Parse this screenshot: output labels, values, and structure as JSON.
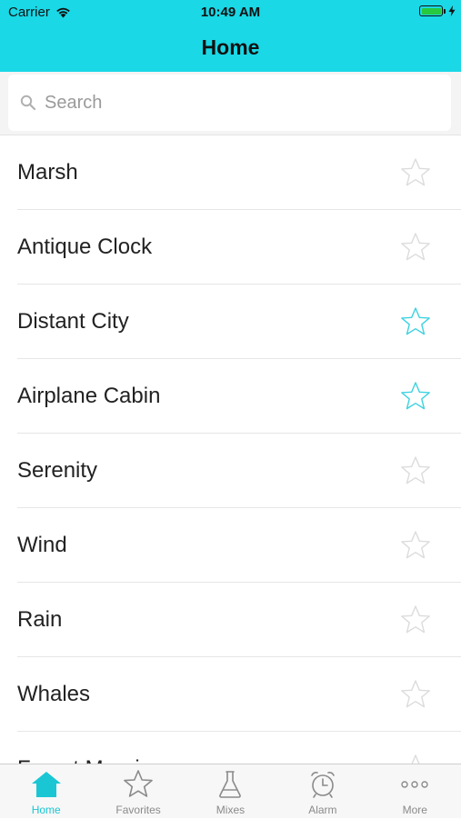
{
  "status_bar": {
    "carrier": "Carrier",
    "time": "10:49 AM",
    "battery_level": 1.0
  },
  "nav": {
    "title": "Home"
  },
  "search": {
    "placeholder": "Search",
    "value": ""
  },
  "colors": {
    "accent": "#1ad8e6",
    "star_inactive": "#dcdcdc",
    "star_active": "#3fd2e0",
    "tab_active": "#1ac6d4",
    "tab_inactive": "#8a8a8a"
  },
  "sounds": [
    {
      "name": "Marsh",
      "favorite": false
    },
    {
      "name": "Antique Clock",
      "favorite": false
    },
    {
      "name": "Distant City",
      "favorite": true
    },
    {
      "name": "Airplane Cabin",
      "favorite": true
    },
    {
      "name": "Serenity",
      "favorite": false
    },
    {
      "name": "Wind",
      "favorite": false
    },
    {
      "name": "Rain",
      "favorite": false
    },
    {
      "name": "Whales",
      "favorite": false
    },
    {
      "name": "Forest Morning",
      "favorite": false
    }
  ],
  "tabs": [
    {
      "label": "Home",
      "icon": "home-icon",
      "active": true
    },
    {
      "label": "Favorites",
      "icon": "star-icon",
      "active": false
    },
    {
      "label": "Mixes",
      "icon": "flask-icon",
      "active": false
    },
    {
      "label": "Alarm",
      "icon": "alarm-clock-icon",
      "active": false
    },
    {
      "label": "More",
      "icon": "more-dots-icon",
      "active": false
    }
  ]
}
